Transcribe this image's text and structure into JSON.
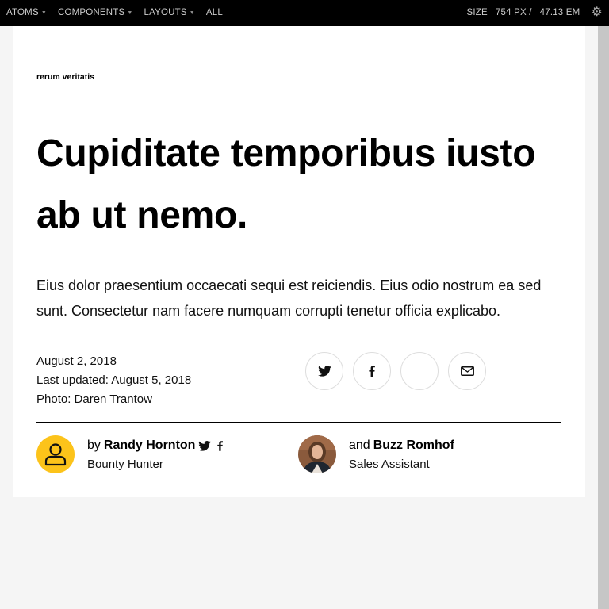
{
  "toolbar": {
    "nav": [
      {
        "label": "ATOMS",
        "has_menu": true
      },
      {
        "label": "COMPONENTS",
        "has_menu": true
      },
      {
        "label": "LAYOUTS",
        "has_menu": true
      },
      {
        "label": "ALL",
        "has_menu": false
      }
    ],
    "size_label": "SIZE",
    "size_px": "754 PX /",
    "size_em": "47.13 EM",
    "settings_icon": "gear-icon"
  },
  "article": {
    "kicker": "rerum veritatis",
    "headline": "Cupiditate temporibus iusto ab ut nemo.",
    "dek": "Eius dolor praesentium occaecati sequi est reiciendis. Eius odio nostrum ea sed sunt. Consectetur nam facere numquam corrupti tenetur officia explicabo.",
    "date": "August 2, 2018",
    "updated": "Last updated: August 5, 2018",
    "photo_credit": "Photo: Daren Trantow",
    "share_icons": [
      "twitter-icon",
      "facebook-icon",
      "blank",
      "mail-icon"
    ]
  },
  "authors": [
    {
      "prefix": "by",
      "name": "Randy Hornton",
      "role": "Bounty Hunter",
      "avatar": "person-placeholder",
      "avatar_color": "#fcc31a",
      "social": [
        "twitter-icon",
        "facebook-icon"
      ]
    },
    {
      "prefix": "and",
      "name": "Buzz Romhof",
      "role": "Sales Assistant",
      "avatar": "photo"
    }
  ]
}
